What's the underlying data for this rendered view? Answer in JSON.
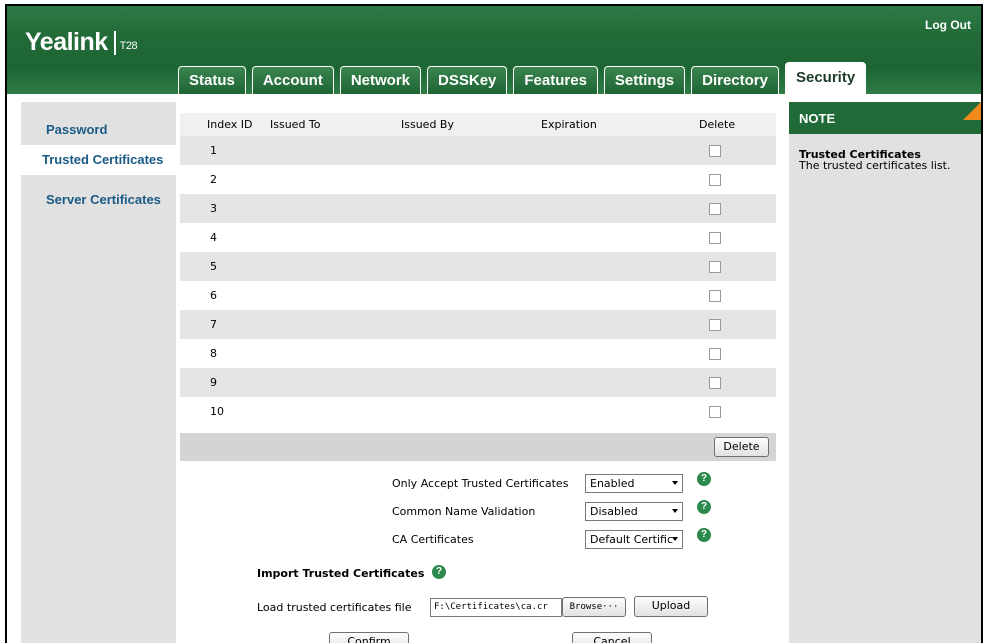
{
  "header": {
    "brand": "Yealink",
    "model": "T28",
    "logout_label": "Log Out"
  },
  "tabs": [
    {
      "label": "Status"
    },
    {
      "label": "Account"
    },
    {
      "label": "Network"
    },
    {
      "label": "DSSKey"
    },
    {
      "label": "Features"
    },
    {
      "label": "Settings"
    },
    {
      "label": "Directory"
    },
    {
      "label": "Security",
      "active": true
    }
  ],
  "sidebar": {
    "items": [
      {
        "label": "Password"
      },
      {
        "label": "Trusted Certificates",
        "active": true
      },
      {
        "label": "Server Certificates"
      }
    ]
  },
  "table": {
    "columns": [
      "Index ID",
      "Issued To",
      "Issued By",
      "Expiration",
      "Delete"
    ],
    "rows": [
      {
        "index": "1",
        "issued_to": "",
        "issued_by": "",
        "expiration": ""
      },
      {
        "index": "2",
        "issued_to": "",
        "issued_by": "",
        "expiration": ""
      },
      {
        "index": "3",
        "issued_to": "",
        "issued_by": "",
        "expiration": ""
      },
      {
        "index": "4",
        "issued_to": "",
        "issued_by": "",
        "expiration": ""
      },
      {
        "index": "5",
        "issued_to": "",
        "issued_by": "",
        "expiration": ""
      },
      {
        "index": "6",
        "issued_to": "",
        "issued_by": "",
        "expiration": ""
      },
      {
        "index": "7",
        "issued_to": "",
        "issued_by": "",
        "expiration": ""
      },
      {
        "index": "8",
        "issued_to": "",
        "issued_by": "",
        "expiration": ""
      },
      {
        "index": "9",
        "issued_to": "",
        "issued_by": "",
        "expiration": ""
      },
      {
        "index": "10",
        "issued_to": "",
        "issued_by": "",
        "expiration": ""
      }
    ],
    "delete_button": "Delete"
  },
  "settings": {
    "only_accept": {
      "label": "Only Accept Trusted Certificates",
      "value": "Enabled"
    },
    "cn_validation": {
      "label": "Common Name Validation",
      "value": "Disabled"
    },
    "ca_certs": {
      "label": "CA Certificates",
      "value": "Default Certific"
    }
  },
  "import": {
    "heading": "Import Trusted Certificates",
    "load_label": "Load trusted certificates file",
    "file_value": "F:\\Certificates\\ca.cr",
    "browse_label": "Browse···",
    "upload_label": "Upload"
  },
  "actions": {
    "confirm_label": "Confirm",
    "cancel_label": "Cancel"
  },
  "note": {
    "heading": "NOTE",
    "title": "Trusted Certificates",
    "text": "The trusted certificates list."
  },
  "help_glyph": "?",
  "colors": {
    "header_green": "#1d6634",
    "nav_blue": "#1a5a86",
    "help_green": "#2d8a4e",
    "note_accent": "#f28a1e"
  }
}
